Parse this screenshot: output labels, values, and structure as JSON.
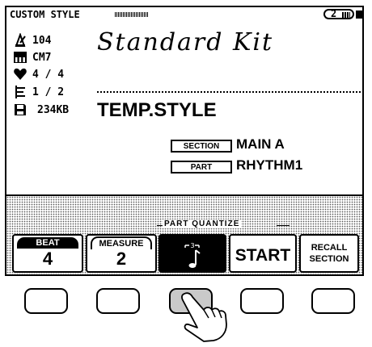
{
  "header": {
    "title": "CUSTOM STYLE",
    "page": "2"
  },
  "info": {
    "tempo": "104",
    "chord": "CM7",
    "time_signature": "4 / 4",
    "measures": "1 / 2",
    "memory": "234KB"
  },
  "icons": {
    "tempo": "metronome-icon",
    "chord": "keyboard-icon",
    "beat": "heart-icon",
    "measure": "score-icon",
    "memory": "disk-icon"
  },
  "style": {
    "name": "Standard Kit",
    "status": "TEMP.STYLE",
    "section_label": "SECTION",
    "section_value": "MAIN A",
    "part_label": "PART",
    "part_value": "RHYTHM1"
  },
  "bottom": {
    "group_label": "PART QUANTIZE",
    "beat_label": "BEAT",
    "beat_value": "4",
    "measure_label": "MEASURE",
    "measure_value": "2",
    "quantize_icon": "triplet-eighth-note-icon",
    "start_label": "START",
    "recall_line1": "RECALL",
    "recall_line2": "SECTION"
  },
  "hardware": {
    "pressed_index": 3
  }
}
